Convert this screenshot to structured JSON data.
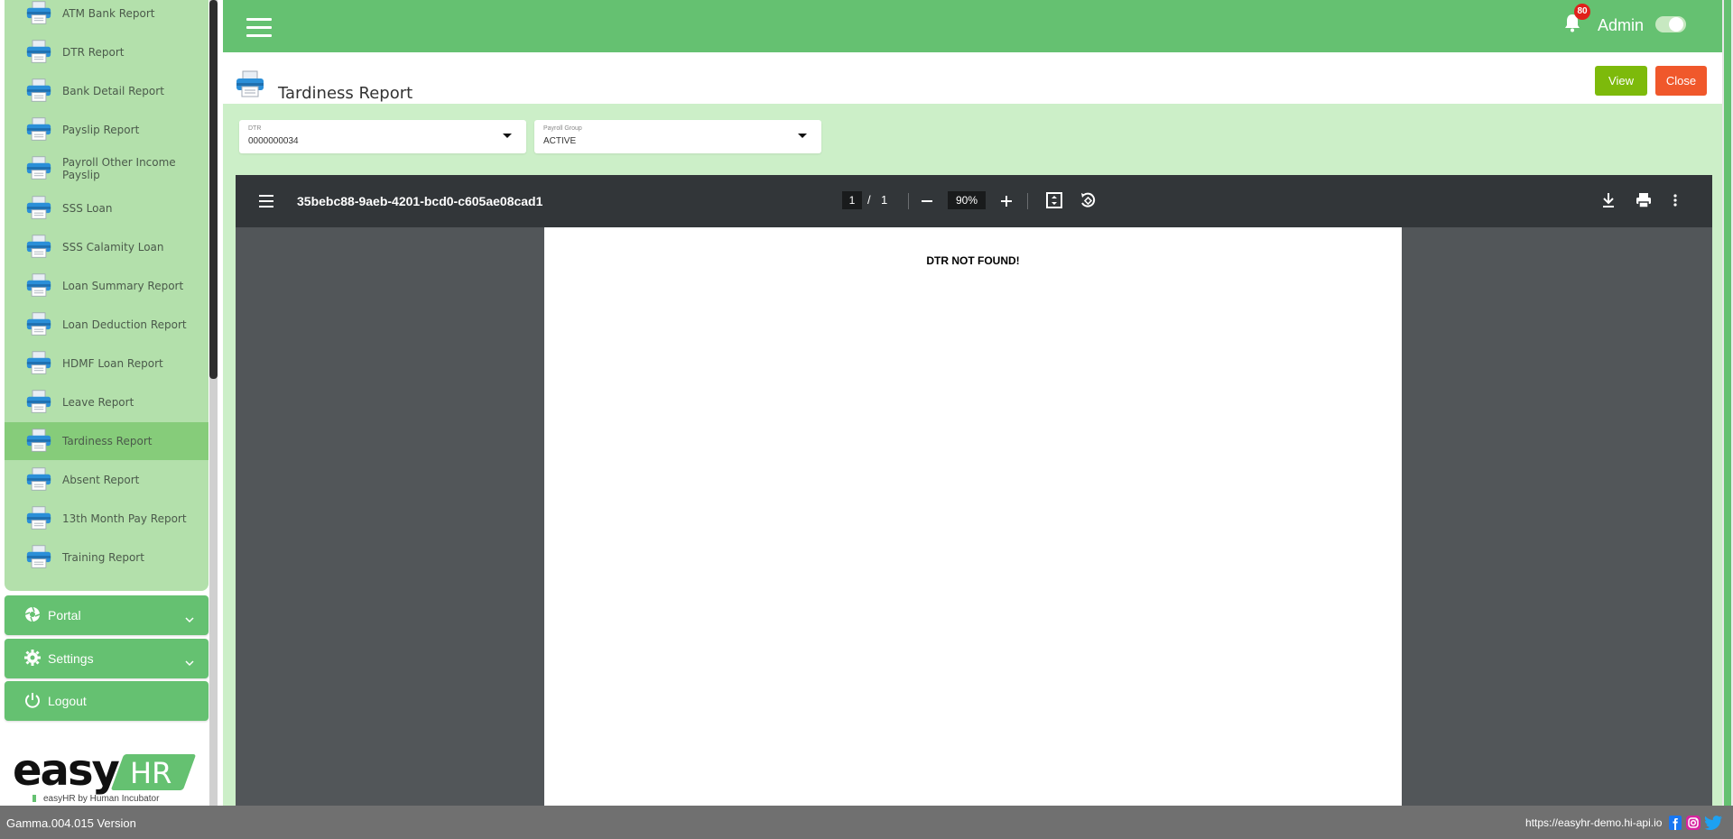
{
  "sidebar": {
    "items": [
      {
        "label": "ATM Bank Report"
      },
      {
        "label": "DTR Report"
      },
      {
        "label": "Bank Detail Report"
      },
      {
        "label": "Payslip Report"
      },
      {
        "label": "Payroll Other Income Payslip"
      },
      {
        "label": "SSS Loan"
      },
      {
        "label": "SSS Calamity Loan"
      },
      {
        "label": "Loan Summary Report"
      },
      {
        "label": "Loan Deduction Report"
      },
      {
        "label": "HDMF Loan Report"
      },
      {
        "label": "Leave Report"
      },
      {
        "label": "Tardiness Report"
      },
      {
        "label": "Absent Report"
      },
      {
        "label": "13th Month Pay Report"
      },
      {
        "label": "Training Report"
      }
    ],
    "active_item": "Tardiness Report",
    "sections": {
      "portal": "Portal",
      "settings": "Settings",
      "logout": "Logout"
    },
    "logo": {
      "word": "easy",
      "badge": "HR",
      "tagline": "easyHR by Human Incubator"
    }
  },
  "header": {
    "notification_count": "80",
    "user": "Admin",
    "dark_mode": false
  },
  "page": {
    "title": "Tardiness Report",
    "view_label": "View",
    "close_label": "Close"
  },
  "filters": {
    "dtr": {
      "label": "DTR",
      "value": "0000000034"
    },
    "payroll_group": {
      "label": "Payroll Group",
      "value": "ACTIVE"
    }
  },
  "pdf": {
    "title": "35bebc88-9aeb-4201-bcd0-c605ae08cad1",
    "page_current": "1",
    "page_separator": "/",
    "page_total": "1",
    "zoom": "90%",
    "message": "DTR NOT FOUND!"
  },
  "footer": {
    "version": "Gamma.004.015 Version",
    "url": "https://easyhr-demo.hi-api.io"
  },
  "colors": {
    "brand_green": "#65c171",
    "light_green": "#ccefc8",
    "sidebar_green": "#b3e0ab",
    "view_button": "#7dba0b",
    "close_button": "#f0582b",
    "badge_red": "#e0201b"
  }
}
